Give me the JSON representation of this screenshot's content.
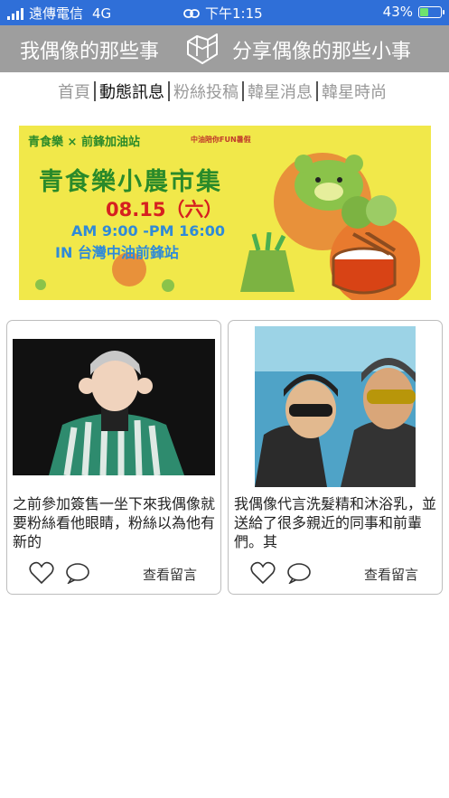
{
  "status_bar": {
    "carrier": "遠傳電信",
    "network": "4G",
    "time": "下午1:15",
    "battery": "43%",
    "battery_level": 0.43
  },
  "header": {
    "left_title": "我偶像的那些事",
    "right_title": "分享偶像的那些小事",
    "logo_icon": "folded-map-icon"
  },
  "nav": {
    "tabs": [
      {
        "label": "首頁",
        "active": false
      },
      {
        "label": "動態訊息",
        "active": true
      },
      {
        "label": "粉絲投稿",
        "active": false
      },
      {
        "label": "韓星消息",
        "active": false
      },
      {
        "label": "韓星時尚",
        "active": false
      }
    ]
  },
  "banner": {
    "brand": "青食樂 × 前鋒加油站",
    "sub": "中油陪你FUN暑假",
    "title": "青食樂小農市集",
    "date": "08.15（六）",
    "time": "AM 9:00 -PM 16:00",
    "location": "IN 台灣中油前鋒站"
  },
  "cards": [
    {
      "text": "之前參加簽售一坐下來我偶像就要粉絲看他眼睛，粉絲以為他有新的",
      "comment_link": "查看留言"
    },
    {
      "text": "我偶像代言洗髮精和沐浴乳，並送給了很多親近的同事和前輩們。其",
      "comment_link": "查看留言"
    }
  ],
  "colors": {
    "status_bar": "#2f6fd8",
    "header": "#9e9e9e",
    "banner_bg": "#f1e84a",
    "banner_green": "#2a8a2a",
    "banner_red": "#d62020",
    "banner_blue": "#2f8ad8"
  }
}
